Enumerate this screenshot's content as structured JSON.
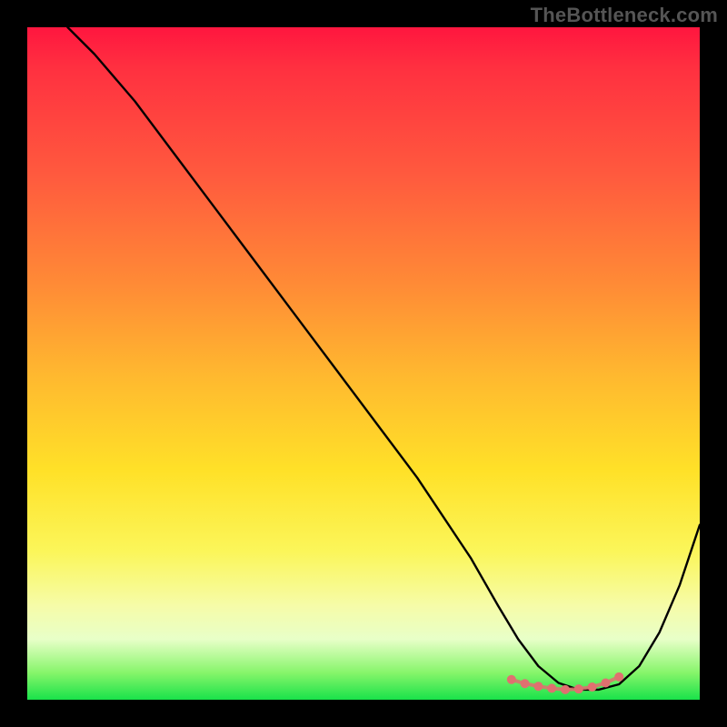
{
  "watermark": "TheBottleneck.com",
  "chart_data": {
    "type": "line",
    "title": "",
    "xlabel": "",
    "ylabel": "",
    "xlim": [
      0,
      100
    ],
    "ylim": [
      0,
      100
    ],
    "grid": false,
    "legend": false,
    "series": [
      {
        "name": "curve",
        "x": [
          6,
          10,
          16,
          22,
          28,
          34,
          40,
          46,
          52,
          58,
          62,
          66,
          70,
          73,
          76,
          79,
          82,
          85,
          88,
          91,
          94,
          97,
          100
        ],
        "y": [
          100,
          96,
          89,
          81,
          73,
          65,
          57,
          49,
          41,
          33,
          27,
          21,
          14,
          9,
          5,
          2.5,
          1.5,
          1.5,
          2.3,
          5,
          10,
          17,
          26
        ],
        "color": "#000000"
      }
    ],
    "markers": {
      "name": "bottom-dots",
      "x": [
        72,
        74,
        76,
        78,
        80,
        82,
        84,
        86,
        88
      ],
      "y": [
        3.0,
        2.4,
        2.0,
        1.7,
        1.5,
        1.6,
        1.9,
        2.5,
        3.4
      ],
      "color": "#e07070"
    }
  }
}
